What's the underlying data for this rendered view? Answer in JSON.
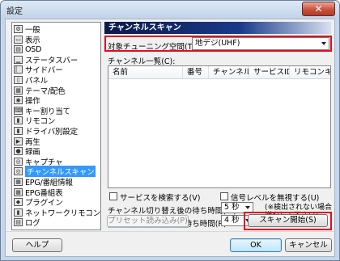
{
  "window": {
    "title": "設定",
    "close_glyph": "✕"
  },
  "sidebar": {
    "items": [
      {
        "label": "一般",
        "icon": "gear-icon",
        "glyph": "⚙"
      },
      {
        "label": "表示",
        "icon": "monitor-icon",
        "glyph": "▭"
      },
      {
        "label": "OSD",
        "icon": "osd-icon",
        "glyph": "▤"
      },
      {
        "label": "ステータスバー",
        "icon": "statusbar-icon",
        "glyph": "▁"
      },
      {
        "label": "サイドバー",
        "icon": "sidebar-icon",
        "glyph": "▏"
      },
      {
        "label": "パネル",
        "icon": "panel-icon",
        "glyph": "▯"
      },
      {
        "label": "テーマ/配色",
        "icon": "theme-icon",
        "glyph": "▦"
      },
      {
        "label": "操作",
        "icon": "operation-icon",
        "glyph": "◉"
      },
      {
        "label": "キー割り当て",
        "icon": "keyboard-icon",
        "glyph": "⌨"
      },
      {
        "label": "リモコン",
        "icon": "remote-icon",
        "glyph": "▮"
      },
      {
        "label": "ドライバ別設定",
        "icon": "driver-icon",
        "glyph": "▮"
      },
      {
        "label": "再生",
        "icon": "play-icon",
        "glyph": "▶"
      },
      {
        "label": "録画",
        "icon": "record-icon",
        "glyph": "●"
      },
      {
        "label": "キャプチャ",
        "icon": "capture-icon",
        "glyph": "◎"
      },
      {
        "label": "チャンネルスキャン",
        "icon": "scan-icon",
        "glyph": "◎",
        "selected": true
      },
      {
        "label": "EPG/番組情報",
        "icon": "epg-icon",
        "glyph": "▦"
      },
      {
        "label": "EPG番組表",
        "icon": "epg-guide-icon",
        "glyph": "▦"
      },
      {
        "label": "プラグイン",
        "icon": "plugin-icon",
        "glyph": "◆"
      },
      {
        "label": "ネットワークリモコン",
        "icon": "network-remote-icon",
        "glyph": "▮"
      },
      {
        "label": "ログ",
        "icon": "log-icon",
        "glyph": "▤"
      }
    ]
  },
  "main": {
    "header": "チャンネルスキャン",
    "tuner_label": "対象チューニング空間(T):",
    "tuner_value": "地デジ(UHF)",
    "list_label": "チャンネル一覧(C):",
    "columns": [
      "名前",
      "番号",
      "チャンネル",
      "サービスID",
      "リモコンキー"
    ],
    "search_service_label": "サービスを検索する(V)",
    "ignore_signal_label": "信号レベルを無視する(U)",
    "wait_time_label": "チャンネル切り替え後の待ち時間(W):",
    "wait_time_value": "5 秒",
    "max_wait_label": "チャンネル検出の最大待ち時間(R):",
    "max_wait_value": "4 秒",
    "note": "(※検出されない場合\n増やして下さい)",
    "preset_button": "プリセット読み込み(P)",
    "scan_button": "スキャン開始(S)"
  },
  "footer": {
    "help": "ヘルプ",
    "ok": "OK",
    "cancel": "キャンセル"
  },
  "colors": {
    "highlight_box": "#e30b1c",
    "selection": "#3399ff",
    "header_bg": "#0a1a4a"
  }
}
